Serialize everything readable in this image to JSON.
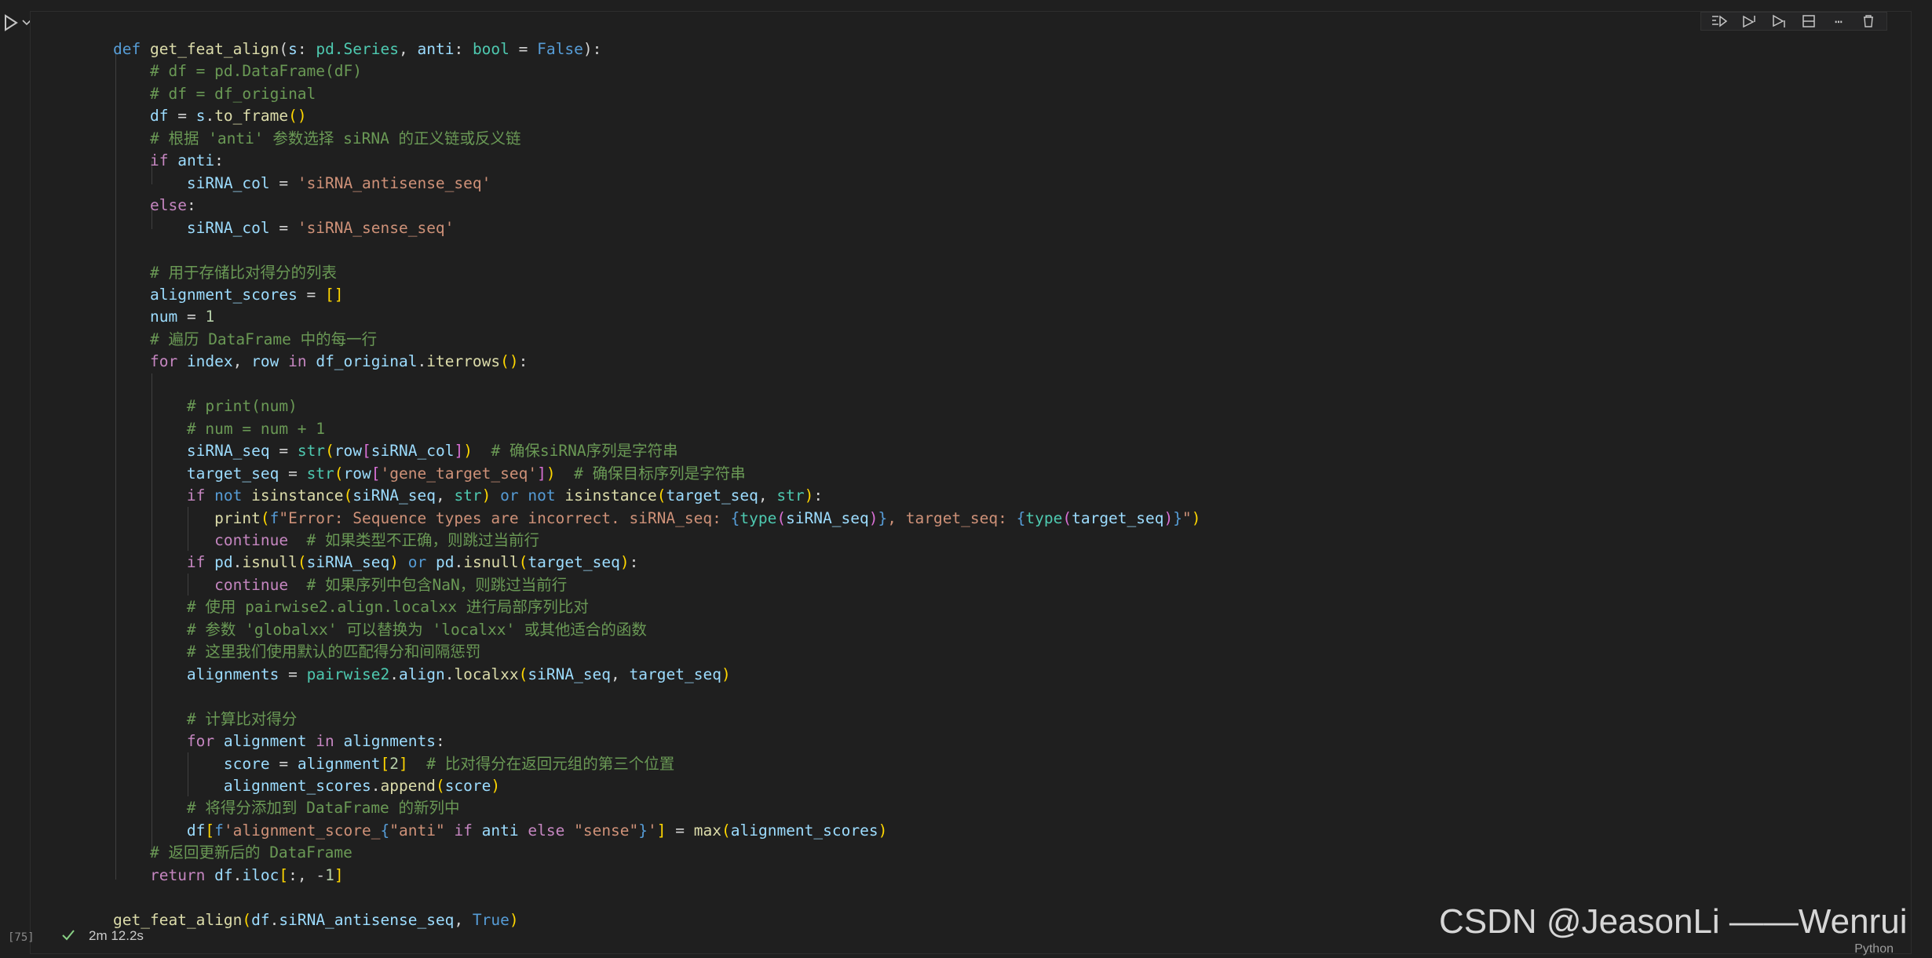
{
  "toolbar": {
    "icons": [
      "run-by-line-icon",
      "execute-above-icon",
      "execute-below-icon",
      "split-cell-icon",
      "more-icon",
      "delete-icon"
    ],
    "more": "⋯"
  },
  "cell": {
    "execution_count": "[75]",
    "elapsed": "2m 12.2s",
    "language": "Python"
  },
  "code_lines": [
    [
      [
        "k",
        "def "
      ],
      [
        "f",
        "get_feat_align"
      ],
      [
        "",
        "("
      ],
      [
        "v",
        "s"
      ],
      [
        "",
        ": "
      ],
      [
        "t",
        "pd.Series"
      ],
      [
        "",
        ", "
      ],
      [
        "v",
        "anti"
      ],
      [
        "",
        ": "
      ],
      [
        "t",
        "bool"
      ],
      [
        "",
        " = "
      ],
      [
        "k",
        "False"
      ],
      [
        "",
        "):"
      ]
    ],
    [
      [
        "",
        "    "
      ],
      [
        "cm",
        "# df = pd.DataFrame(dF)"
      ]
    ],
    [
      [
        "",
        "    "
      ],
      [
        "cm",
        "# df = df_original"
      ]
    ],
    [
      [
        "",
        "    "
      ],
      [
        "v",
        "df"
      ],
      [
        "",
        " = "
      ],
      [
        "v",
        "s"
      ],
      [
        "",
        "."
      ],
      [
        "f",
        "to_frame"
      ],
      [
        "y",
        "()"
      ]
    ],
    [
      [
        "",
        "    "
      ],
      [
        "cm",
        "# 根据 'anti' 参数选择 siRNA 的正义链或反义链"
      ]
    ],
    [
      [
        "",
        "    "
      ],
      [
        "c",
        "if "
      ],
      [
        "v",
        "anti"
      ],
      [
        "",
        ":"
      ]
    ],
    [
      [
        "",
        "        "
      ],
      [
        "v",
        "siRNA_col"
      ],
      [
        "",
        " = "
      ],
      [
        "s",
        "'siRNA_antisense_seq'"
      ]
    ],
    [
      [
        "",
        "    "
      ],
      [
        "c",
        "else"
      ],
      [
        "",
        ":"
      ]
    ],
    [
      [
        "",
        "        "
      ],
      [
        "v",
        "siRNA_col"
      ],
      [
        "",
        " = "
      ],
      [
        "s",
        "'siRNA_sense_seq'"
      ]
    ],
    [
      [
        "",
        ""
      ]
    ],
    [
      [
        "",
        "    "
      ],
      [
        "cm",
        "# 用于存储比对得分的列表"
      ]
    ],
    [
      [
        "",
        "    "
      ],
      [
        "v",
        "alignment_scores"
      ],
      [
        "",
        " = "
      ],
      [
        "y",
        "[]"
      ]
    ],
    [
      [
        "",
        "    "
      ],
      [
        "v",
        "num"
      ],
      [
        "",
        " = "
      ],
      [
        "n",
        "1"
      ]
    ],
    [
      [
        "",
        "    "
      ],
      [
        "cm",
        "# 遍历 DataFrame 中的每一行"
      ]
    ],
    [
      [
        "",
        "    "
      ],
      [
        "c",
        "for "
      ],
      [
        "v",
        "index"
      ],
      [
        "",
        ", "
      ],
      [
        "v",
        "row"
      ],
      [
        "c",
        " in "
      ],
      [
        "v",
        "df_original"
      ],
      [
        "",
        "."
      ],
      [
        "f",
        "iterrows"
      ],
      [
        "y",
        "()"
      ],
      [
        "",
        ":"
      ]
    ],
    [
      [
        "",
        ""
      ]
    ],
    [
      [
        "",
        "        "
      ],
      [
        "cm",
        "# print(num)"
      ]
    ],
    [
      [
        "",
        "        "
      ],
      [
        "cm",
        "# num = num + 1"
      ]
    ],
    [
      [
        "",
        "        "
      ],
      [
        "v",
        "siRNA_seq"
      ],
      [
        "",
        " = "
      ],
      [
        "t",
        "str"
      ],
      [
        "y",
        "("
      ],
      [
        "v",
        "row"
      ],
      [
        "p",
        "["
      ],
      [
        "v",
        "siRNA_col"
      ],
      [
        "p",
        "]"
      ],
      [
        "y",
        ")"
      ],
      [
        "",
        "  "
      ],
      [
        "cm",
        "# 确保siRNA序列是字符串"
      ]
    ],
    [
      [
        "",
        "        "
      ],
      [
        "v",
        "target_seq"
      ],
      [
        "",
        " = "
      ],
      [
        "t",
        "str"
      ],
      [
        "y",
        "("
      ],
      [
        "v",
        "row"
      ],
      [
        "p",
        "["
      ],
      [
        "s",
        "'gene_target_seq'"
      ],
      [
        "p",
        "]"
      ],
      [
        "y",
        ")"
      ],
      [
        "",
        "  "
      ],
      [
        "cm",
        "# 确保目标序列是字符串"
      ]
    ],
    [
      [
        "",
        "        "
      ],
      [
        "c",
        "if "
      ],
      [
        "k",
        "not "
      ],
      [
        "f",
        "isinstance"
      ],
      [
        "y",
        "("
      ],
      [
        "v",
        "siRNA_seq"
      ],
      [
        "",
        ", "
      ],
      [
        "t",
        "str"
      ],
      [
        "y",
        ")"
      ],
      [
        "k",
        " or not "
      ],
      [
        "f",
        "isinstance"
      ],
      [
        "y",
        "("
      ],
      [
        "v",
        "target_seq"
      ],
      [
        "",
        ", "
      ],
      [
        "t",
        "str"
      ],
      [
        "y",
        ")"
      ],
      [
        "",
        ":"
      ]
    ],
    [
      [
        "",
        "           "
      ],
      [
        "f",
        "print"
      ],
      [
        "y",
        "("
      ],
      [
        "k",
        "f"
      ],
      [
        "s",
        "\"Error: Sequence types are incorrect. siRNA_seq: "
      ],
      [
        "k",
        "{"
      ],
      [
        "t",
        "type"
      ],
      [
        "p",
        "("
      ],
      [
        "v",
        "siRNA_seq"
      ],
      [
        "p",
        ")"
      ],
      [
        "k",
        "}"
      ],
      [
        "s",
        ", target_seq: "
      ],
      [
        "k",
        "{"
      ],
      [
        "t",
        "type"
      ],
      [
        "p",
        "("
      ],
      [
        "v",
        "target_seq"
      ],
      [
        "p",
        ")"
      ],
      [
        "k",
        "}"
      ],
      [
        "s",
        "\""
      ],
      [
        "y",
        ")"
      ]
    ],
    [
      [
        "",
        "           "
      ],
      [
        "c",
        "continue"
      ],
      [
        "",
        "  "
      ],
      [
        "cm",
        "# 如果类型不正确，则跳过当前行"
      ]
    ],
    [
      [
        "",
        "        "
      ],
      [
        "c",
        "if "
      ],
      [
        "v",
        "pd"
      ],
      [
        "",
        "."
      ],
      [
        "f",
        "isnull"
      ],
      [
        "y",
        "("
      ],
      [
        "v",
        "siRNA_seq"
      ],
      [
        "y",
        ")"
      ],
      [
        "k",
        " or "
      ],
      [
        "v",
        "pd"
      ],
      [
        "",
        "."
      ],
      [
        "f",
        "isnull"
      ],
      [
        "y",
        "("
      ],
      [
        "v",
        "target_seq"
      ],
      [
        "y",
        ")"
      ],
      [
        "",
        ":"
      ]
    ],
    [
      [
        "",
        "           "
      ],
      [
        "c",
        "continue"
      ],
      [
        "",
        "  "
      ],
      [
        "cm",
        "# 如果序列中包含NaN，则跳过当前行"
      ]
    ],
    [
      [
        "",
        "        "
      ],
      [
        "cm",
        "# 使用 pairwise2.align.localxx 进行局部序列比对"
      ]
    ],
    [
      [
        "",
        "        "
      ],
      [
        "cm",
        "# 参数 'globalxx' 可以替换为 'localxx' 或其他适合的函数"
      ]
    ],
    [
      [
        "",
        "        "
      ],
      [
        "cm",
        "# 这里我们使用默认的匹配得分和间隔惩罚"
      ]
    ],
    [
      [
        "",
        "        "
      ],
      [
        "v",
        "alignments"
      ],
      [
        "",
        " = "
      ],
      [
        "t",
        "pairwise2"
      ],
      [
        "",
        "."
      ],
      [
        "v",
        "align"
      ],
      [
        "",
        "."
      ],
      [
        "f",
        "localxx"
      ],
      [
        "y",
        "("
      ],
      [
        "v",
        "siRNA_seq"
      ],
      [
        "",
        ", "
      ],
      [
        "v",
        "target_seq"
      ],
      [
        "y",
        ")"
      ]
    ],
    [
      [
        "",
        ""
      ]
    ],
    [
      [
        "",
        "        "
      ],
      [
        "cm",
        "# 计算比对得分"
      ]
    ],
    [
      [
        "",
        "        "
      ],
      [
        "c",
        "for "
      ],
      [
        "v",
        "alignment"
      ],
      [
        "c",
        " in "
      ],
      [
        "v",
        "alignments"
      ],
      [
        "",
        ":"
      ]
    ],
    [
      [
        "",
        "            "
      ],
      [
        "v",
        "score"
      ],
      [
        "",
        " = "
      ],
      [
        "v",
        "alignment"
      ],
      [
        "y",
        "["
      ],
      [
        "n",
        "2"
      ],
      [
        "y",
        "]"
      ],
      [
        "",
        "  "
      ],
      [
        "cm",
        "# 比对得分在返回元组的第三个位置"
      ]
    ],
    [
      [
        "",
        "            "
      ],
      [
        "v",
        "alignment_scores"
      ],
      [
        "",
        "."
      ],
      [
        "f",
        "append"
      ],
      [
        "y",
        "("
      ],
      [
        "v",
        "score"
      ],
      [
        "y",
        ")"
      ]
    ],
    [
      [
        "",
        "        "
      ],
      [
        "cm",
        "# 将得分添加到 DataFrame 的新列中"
      ]
    ],
    [
      [
        "",
        "        "
      ],
      [
        "v",
        "df"
      ],
      [
        "y",
        "["
      ],
      [
        "k",
        "f"
      ],
      [
        "s",
        "'alignment_score_"
      ],
      [
        "k",
        "{"
      ],
      [
        "s",
        "\"anti\""
      ],
      [
        "c",
        " if "
      ],
      [
        "v",
        "anti"
      ],
      [
        "c",
        " else "
      ],
      [
        "s",
        "\"sense\""
      ],
      [
        "k",
        "}"
      ],
      [
        "s",
        "'"
      ],
      [
        "y",
        "]"
      ],
      [
        "",
        " = "
      ],
      [
        "f",
        "max"
      ],
      [
        "y",
        "("
      ],
      [
        "v",
        "alignment_scores"
      ],
      [
        "y",
        ")"
      ]
    ],
    [
      [
        "",
        "    "
      ],
      [
        "cm",
        "# 返回更新后的 DataFrame"
      ]
    ],
    [
      [
        "",
        "    "
      ],
      [
        "c",
        "return "
      ],
      [
        "v",
        "df"
      ],
      [
        "",
        "."
      ],
      [
        "v",
        "iloc"
      ],
      [
        "y",
        "["
      ],
      [
        "",
        ":, -"
      ],
      [
        "n",
        "1"
      ],
      [
        "y",
        "]"
      ]
    ],
    [
      [
        "",
        ""
      ]
    ],
    [
      [
        "f",
        "get_feat_align"
      ],
      [
        "y",
        "("
      ],
      [
        "v",
        "df"
      ],
      [
        "",
        "."
      ],
      [
        "v",
        "siRNA_antisense_seq"
      ],
      [
        "",
        ", "
      ],
      [
        "k",
        "True"
      ],
      [
        "y",
        ")"
      ]
    ]
  ],
  "watermark": "CSDN @JeasonLi ——Wenrui"
}
